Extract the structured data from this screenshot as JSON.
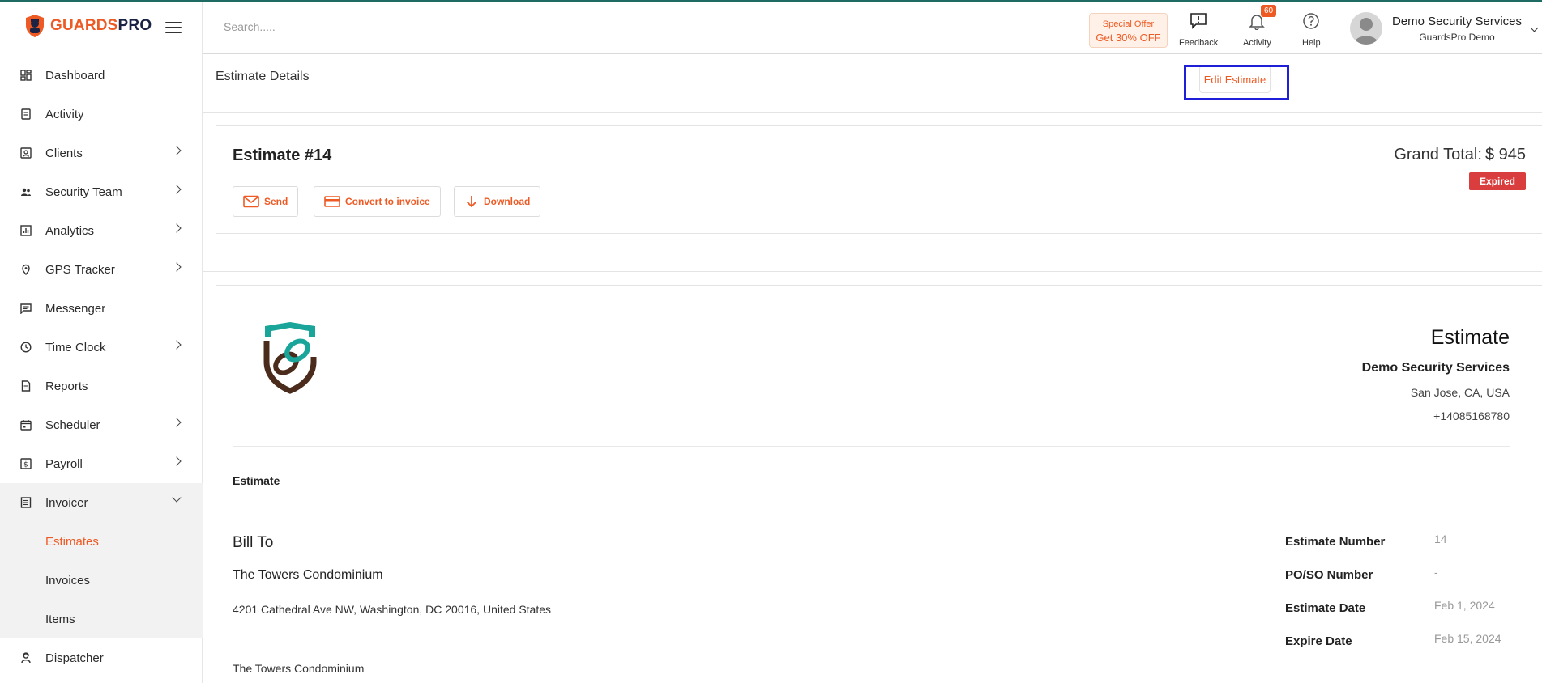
{
  "brand": {
    "part1": "GUARDS",
    "part2": "PRO",
    "accent": "#ee5a24",
    "dark": "#1a2344"
  },
  "sidebar": {
    "items": [
      {
        "label": "Dashboard",
        "icon": "dashboard-icon"
      },
      {
        "label": "Activity",
        "icon": "activity-icon"
      },
      {
        "label": "Clients",
        "icon": "clients-icon"
      },
      {
        "label": "Security Team",
        "icon": "team-icon"
      },
      {
        "label": "Analytics",
        "icon": "analytics-icon"
      },
      {
        "label": "GPS Tracker",
        "icon": "location-pin-icon"
      },
      {
        "label": "Messenger",
        "icon": "message-icon"
      },
      {
        "label": "Time Clock",
        "icon": "clock-icon"
      },
      {
        "label": "Reports",
        "icon": "report-icon"
      },
      {
        "label": "Scheduler",
        "icon": "calendar-icon"
      },
      {
        "label": "Payroll",
        "icon": "payroll-icon"
      },
      {
        "label": "Invoicer",
        "icon": "invoice-icon"
      },
      {
        "label": "Dispatcher",
        "icon": "dispatcher-icon"
      }
    ],
    "invoicer_sub": [
      {
        "label": "Estimates"
      },
      {
        "label": "Invoices"
      },
      {
        "label": "Items"
      }
    ]
  },
  "header": {
    "search_placeholder": "Search.....",
    "offer_line1": "Special Offer",
    "offer_line2": "Get 30% OFF",
    "feedback": "Feedback",
    "activity": "Activity",
    "activity_badge": "60",
    "help": "Help",
    "user_name": "Demo Security Services",
    "user_company": "GuardsPro Demo"
  },
  "page": {
    "title": "Estimate Details",
    "edit_label": "Edit Estimate"
  },
  "estimate": {
    "number_label": "Estimate #14",
    "send": "Send",
    "convert": "Convert to invoice",
    "download": "Download",
    "grand_total_label": "Grand Total:",
    "grand_total_value": "$ 945",
    "status": "Expired",
    "status_color": "#d93d3d"
  },
  "document": {
    "title": "Estimate",
    "company": "Demo Security Services",
    "location": "San Jose, CA, USA",
    "phone": "+14085168780",
    "section_label": "Estimate",
    "bill_to_title": "Bill To",
    "bill_to_name": "The Towers Condominium",
    "bill_to_address": "4201 Cathedral Ave NW, Washington, DC 20016, United States",
    "bill_to_name2": "The Towers Condominium",
    "meta": [
      {
        "label": "Estimate Number",
        "value": "14"
      },
      {
        "label": "PO/SO Number",
        "value": "-"
      },
      {
        "label": "Estimate Date",
        "value": "Feb 1, 2024"
      },
      {
        "label": "Expire Date",
        "value": "Feb 15, 2024"
      }
    ]
  }
}
